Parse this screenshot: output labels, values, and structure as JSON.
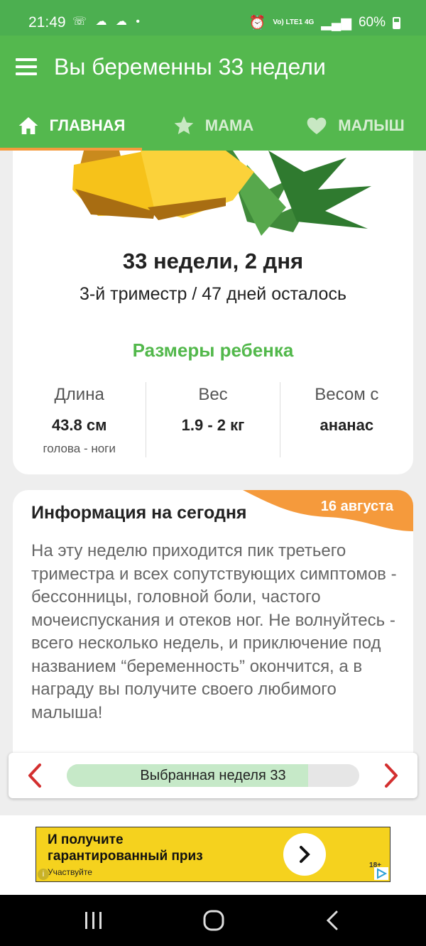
{
  "status": {
    "time": "21:49",
    "notifications": "☏ ☁ ☁ •",
    "network": "Vo) LTE1 4G",
    "battery": "60%"
  },
  "appbar": {
    "title": "Вы беременны 33 недели"
  },
  "tabs": [
    {
      "label": "ГЛАВНАЯ",
      "icon": "home-icon",
      "active": true
    },
    {
      "label": "МАМА",
      "icon": "star-icon",
      "active": false
    },
    {
      "label": "МАЛЫШ",
      "icon": "heart-icon",
      "active": false
    }
  ],
  "summary": {
    "week": "33 недели, 2 дня",
    "trimester": "3-й триместр / 47 дней осталось",
    "sizes_title": "Размеры ребенка",
    "length": {
      "label": "Длина",
      "value": "43.8 см",
      "note": "голова - ноги"
    },
    "weight": {
      "label": "Вес",
      "value": "1.9 - 2 кг"
    },
    "size_like": {
      "label": "Весом с",
      "value": "ананас"
    }
  },
  "info": {
    "title": "Информация на сегодня",
    "date": "16 августа",
    "text": "На эту неделю приходится пик третьего триместра и всех сопутствующих симптомов - бессонницы, головной боли, частого мочеиспускания и отеков ног. Не волнуйтесь - всего несколько недель, и приключение под названием “беременность” окончится, а в награду вы получите своего любимого малыша!"
  },
  "week_selector": {
    "label": "Выбранная неделя 33",
    "progress": 0.825
  },
  "ad": {
    "headline_1": "И получите",
    "headline_2": "гарантированный приз",
    "sub": "Участвуйте",
    "age": "18+"
  },
  "colors": {
    "primary": "#54b84e",
    "accent": "#f59a3c",
    "week_fill": "#c6e9c8"
  }
}
